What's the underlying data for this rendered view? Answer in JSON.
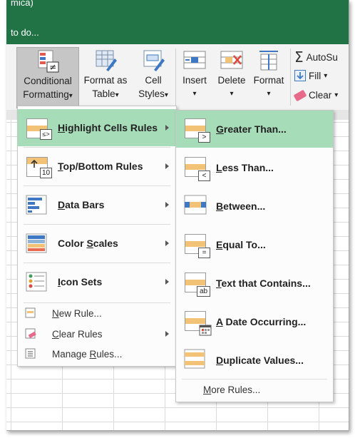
{
  "titlebar": {
    "line1": "mica)",
    "line2": "to do..."
  },
  "ribbon": {
    "conditional_formatting": {
      "line1": "Conditional",
      "line2": "Formatting"
    },
    "format_as_table": {
      "line1": "Format as",
      "line2": "Table"
    },
    "cell_styles": {
      "line1": "Cell",
      "line2": "Styles"
    },
    "insert": "Insert",
    "delete": "Delete",
    "format": "Format",
    "autosum": "AutoSu",
    "fill": "Fill",
    "clear": "Clear",
    "dropdown_glyph": "▾"
  },
  "menu": {
    "items": [
      {
        "label_pre": "",
        "label_key": "H",
        "label_post": "ighlight Cells Rules",
        "icon": "highlight-cells-icon"
      },
      {
        "label_pre": "",
        "label_key": "T",
        "label_post": "op/Bottom Rules",
        "icon": "top-bottom-icon",
        "badge": "10"
      },
      {
        "label_pre": "",
        "label_key": "D",
        "label_post": "ata Bars",
        "icon": "data-bars-icon"
      },
      {
        "label_pre": "Color ",
        "label_key": "S",
        "label_post": "cales",
        "icon": "color-scales-icon"
      },
      {
        "label_pre": "",
        "label_key": "I",
        "label_post": "con Sets",
        "icon": "icon-sets-icon"
      }
    ],
    "small_items": [
      {
        "label_pre": "",
        "label_key": "N",
        "label_post": "ew Rule...",
        "icon": "new-rule-icon"
      },
      {
        "label_pre": "",
        "label_key": "C",
        "label_post": "lear Rules",
        "icon": "clear-rules-icon"
      },
      {
        "label_pre": "Manage ",
        "label_key": "R",
        "label_post": "ules...",
        "icon": "manage-rules-icon"
      }
    ]
  },
  "submenu": {
    "items": [
      {
        "label_pre": "",
        "label_key": "G",
        "label_post": "reater Than...",
        "badge": ">"
      },
      {
        "label_pre": "",
        "label_key": "L",
        "label_post": "ess Than...",
        "badge": "<"
      },
      {
        "label_pre": "",
        "label_key": "B",
        "label_post": "etween...",
        "badge": ""
      },
      {
        "label_pre": "",
        "label_key": "E",
        "label_post": "qual To...",
        "badge": "="
      },
      {
        "label_pre": "",
        "label_key": "T",
        "label_post": "ext that Contains...",
        "badge": "ab"
      },
      {
        "label_pre": "",
        "label_key": "A",
        "label_post": " Date Occurring...",
        "badge": ""
      },
      {
        "label_pre": "",
        "label_key": "D",
        "label_post": "uplicate Values...",
        "badge": ""
      }
    ],
    "more_pre": "",
    "more_key": "M",
    "more_post": "ore Rules..."
  },
  "colors": {
    "excel_green": "#217346",
    "highlight": "#a7dcb9",
    "icon_orange": "#f2c277",
    "icon_blue": "#3e78c4"
  }
}
